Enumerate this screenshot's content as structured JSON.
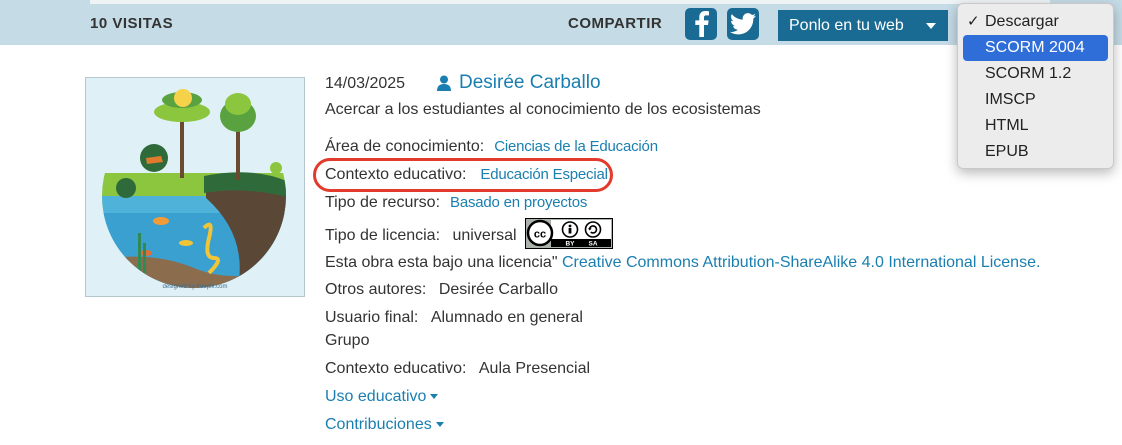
{
  "header": {
    "visits": "10 VISITAS",
    "share": "COMPARTIR",
    "embed_button": "Ponlo en tu web"
  },
  "download_menu": {
    "items": [
      {
        "label": "Descargar",
        "checked": true
      },
      {
        "label": "SCORM 2004",
        "selected": true
      },
      {
        "label": "SCORM 1.2"
      },
      {
        "label": "IMSCP"
      },
      {
        "label": "HTML"
      },
      {
        "label": "EPUB"
      }
    ]
  },
  "resource": {
    "date": "14/03/2025",
    "author": "Desirée Carballo",
    "description": "Acercar a los estudiantes al conocimiento de los ecosistemas",
    "knowledge_area_label": "Área de conocimiento:",
    "knowledge_area_value": "Ciencias de la Educación",
    "edu_context_label": "Contexto educativo:",
    "edu_context_value": "Educación Especial",
    "resource_type_label": "Tipo de recurso:",
    "resource_type_value": "Basado en proyectos",
    "license_type_label": "Tipo de licencia:",
    "license_type_value": "universal",
    "license_text_prefix": "Esta obra esta bajo una licencia\"",
    "license_link": "Creative Commons Attribution-ShareAlike 4.0 International License.",
    "other_authors_label": "Otros autores:",
    "other_authors_value": "Desirée Carballo",
    "end_user_label": "Usuario final:",
    "end_user_value": "Alumnado en general",
    "group_label": "Grupo",
    "edu_context2_label": "Contexto educativo:",
    "edu_context2_value": "Aula Presencial",
    "edu_use": "Uso educativo",
    "contributions": "Contribuciones"
  },
  "thumbnail": {
    "credit": "designed by freepik.com"
  },
  "colors": {
    "topbar": "#c5dbe6",
    "accent": "#1a6b93",
    "link": "#1a7fb0",
    "highlight": "#e23a2c",
    "menu_selected": "#2f6ed8"
  },
  "icons": [
    "facebook-icon",
    "twitter-icon",
    "caret-down-icon",
    "user-icon",
    "check-icon",
    "cc-by-sa-badge"
  ]
}
